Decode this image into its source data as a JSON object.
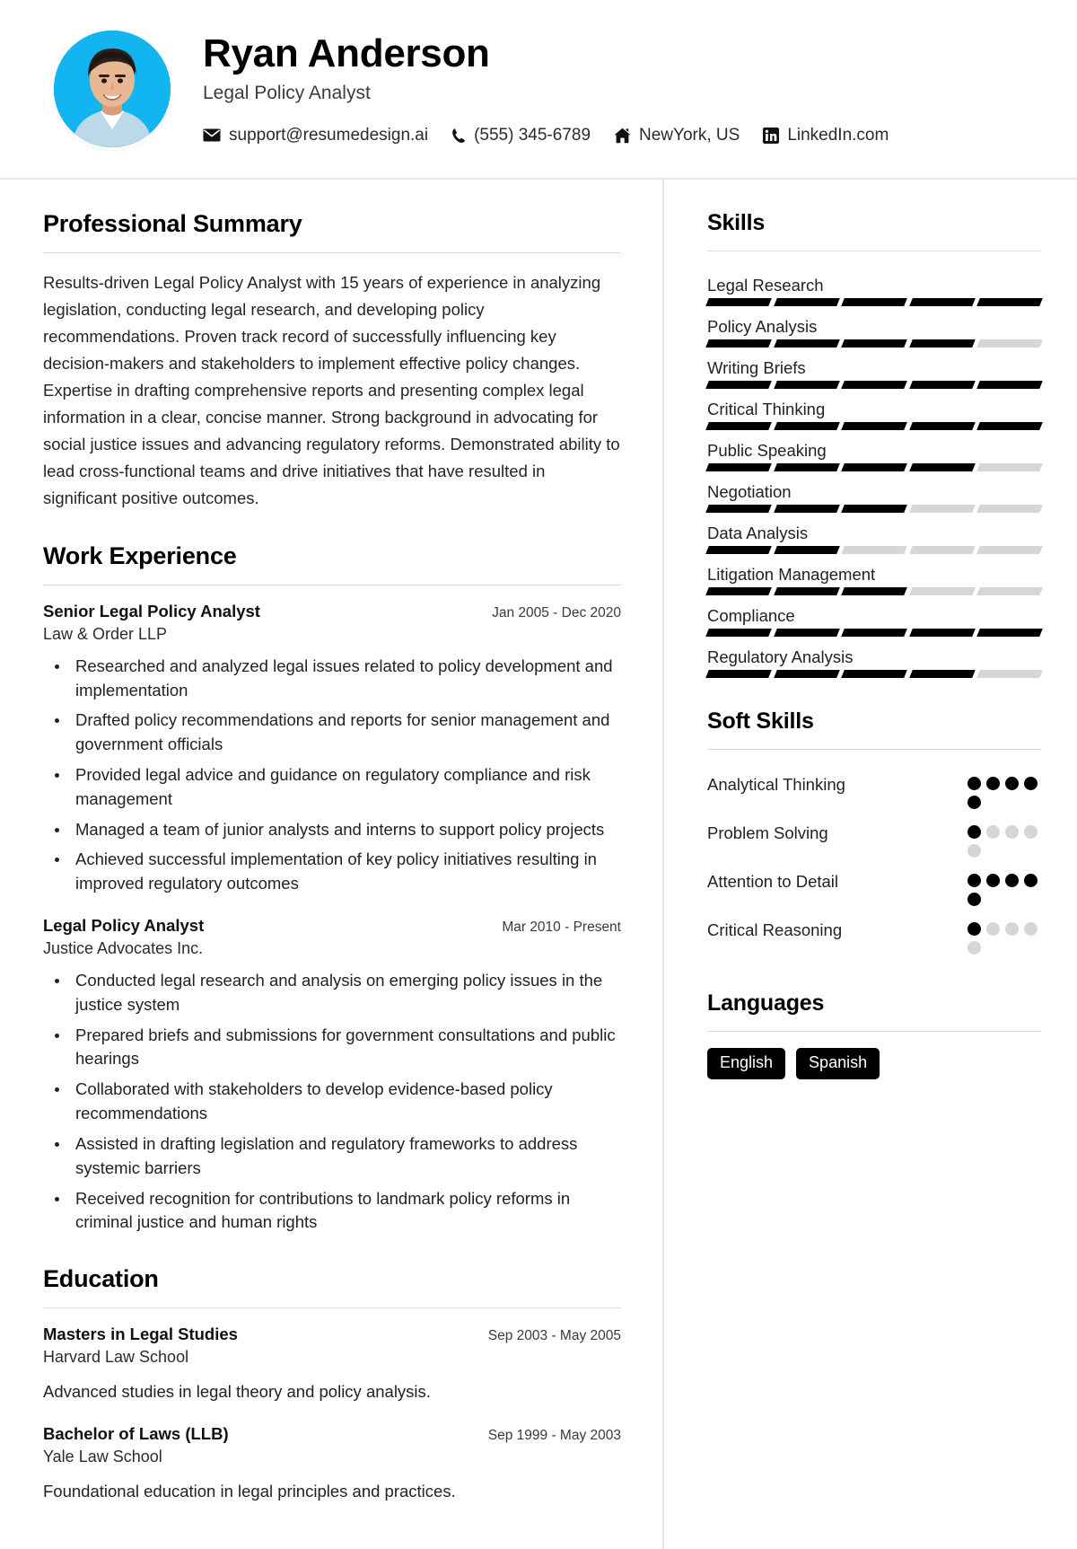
{
  "header": {
    "name": "Ryan Anderson",
    "title": "Legal Policy Analyst",
    "avatar_alt": "profile-photo",
    "contacts": [
      {
        "icon": "envelope-icon",
        "text": "support@resumedesign.ai"
      },
      {
        "icon": "phone-icon",
        "text": "(555) 345-6789"
      },
      {
        "icon": "home-icon",
        "text": "NewYork, US"
      },
      {
        "icon": "linkedin-icon",
        "text": "LinkedIn.com"
      }
    ]
  },
  "summary": {
    "heading": "Professional Summary",
    "text": "Results-driven Legal Policy Analyst with 15 years of experience in analyzing legislation, conducting legal research, and developing policy recommendations. Proven track record of successfully influencing key decision-makers and stakeholders to implement effective policy changes. Expertise in drafting comprehensive reports and presenting complex legal information in a clear, concise manner. Strong background in advocating for social justice issues and advancing regulatory reforms. Demonstrated ability to lead cross-functional teams and drive initiatives that have resulted in significant positive outcomes."
  },
  "experience": {
    "heading": "Work Experience",
    "jobs": [
      {
        "role": "Senior Legal Policy Analyst",
        "date": "Jan 2005 - Dec 2020",
        "org": "Law & Order LLP",
        "bullets": [
          "Researched and analyzed legal issues related to policy development and implementation",
          "Drafted policy recommendations and reports for senior management and government officials",
          "Provided legal advice and guidance on regulatory compliance and risk management",
          "Managed a team of junior analysts and interns to support policy projects",
          "Achieved successful implementation of key policy initiatives resulting in improved regulatory outcomes"
        ]
      },
      {
        "role": "Legal Policy Analyst",
        "date": "Mar 2010 - Present",
        "org": "Justice Advocates Inc.",
        "bullets": [
          "Conducted legal research and analysis on emerging policy issues in the justice system",
          "Prepared briefs and submissions for government consultations and public hearings",
          "Collaborated with stakeholders to develop evidence-based policy recommendations",
          "Assisted in drafting legislation and regulatory frameworks to address systemic barriers",
          "Received recognition for contributions to landmark policy reforms in criminal justice and human rights"
        ]
      }
    ]
  },
  "education": {
    "heading": "Education",
    "items": [
      {
        "degree": "Masters in Legal Studies",
        "date": "Sep 2003 - May 2005",
        "school": "Harvard Law School",
        "desc": "Advanced studies in legal theory and policy analysis."
      },
      {
        "degree": "Bachelor of Laws (LLB)",
        "date": "Sep 1999 - May 2003",
        "school": "Yale Law School",
        "desc": "Foundational education in legal principles and practices."
      }
    ]
  },
  "skills": {
    "heading": "Skills",
    "max": 5,
    "items": [
      {
        "name": "Legal Research",
        "level": 5
      },
      {
        "name": "Policy Analysis",
        "level": 4
      },
      {
        "name": "Writing Briefs",
        "level": 5
      },
      {
        "name": "Critical Thinking",
        "level": 5
      },
      {
        "name": "Public Speaking",
        "level": 4
      },
      {
        "name": "Negotiation",
        "level": 3
      },
      {
        "name": "Data Analysis",
        "level": 2
      },
      {
        "name": "Litigation Management",
        "level": 3
      },
      {
        "name": "Compliance",
        "level": 5
      },
      {
        "name": "Regulatory Analysis",
        "level": 4
      }
    ]
  },
  "soft_skills": {
    "heading": "Soft Skills",
    "max": 5,
    "items": [
      {
        "name": "Analytical Thinking",
        "level": 5
      },
      {
        "name": "Problem Solving",
        "level": 1
      },
      {
        "name": "Attention to Detail",
        "level": 5
      },
      {
        "name": "Critical Reasoning",
        "level": 1
      }
    ]
  },
  "languages": {
    "heading": "Languages",
    "items": [
      "English",
      "Spanish"
    ]
  },
  "colors": {
    "accent": "#000000",
    "muted_bar": "#d6d6d6",
    "avatar_bg": "#13b5f0",
    "rule": "#dcdcdc"
  }
}
